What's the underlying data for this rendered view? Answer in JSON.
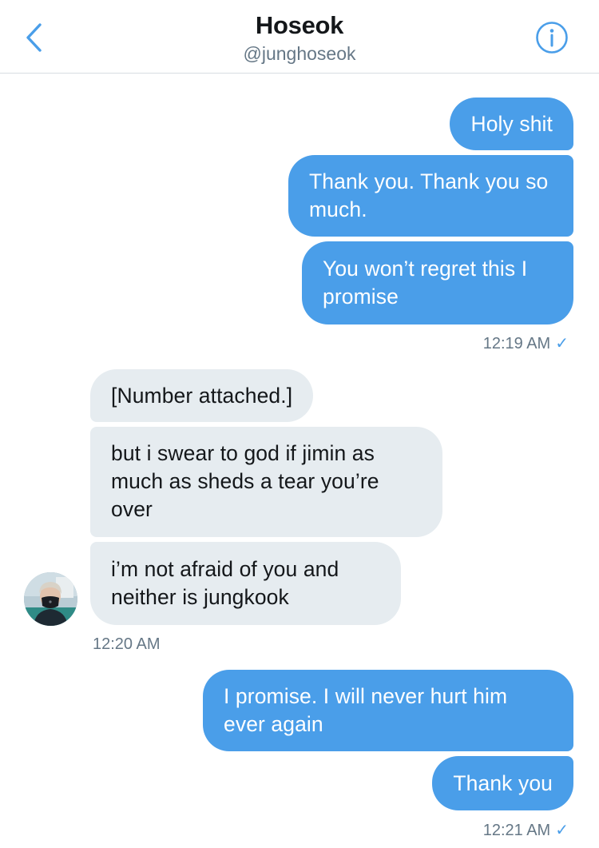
{
  "header": {
    "name": "Hoseok",
    "handle": "@junghoseok",
    "back_icon": "chevron-left-icon",
    "info_icon": "info-icon"
  },
  "colors": {
    "sent_bubble": "#4a9ee9",
    "received_bubble": "#e6ecf0",
    "accent": "#4a9ee9"
  },
  "messages": [
    {
      "direction": "sent",
      "text": "Holy shit"
    },
    {
      "direction": "sent",
      "text": "Thank you. Thank you so much."
    },
    {
      "direction": "sent",
      "text": "You won’t regret this I promise"
    },
    {
      "direction": "received",
      "text": "[Number attached.]"
    },
    {
      "direction": "received",
      "text": "but i swear to god if jimin as much as sheds a tear you’re over"
    },
    {
      "direction": "received",
      "text": "i’m not afraid of you and neither is jungkook"
    },
    {
      "direction": "sent",
      "text": "I promise. I will never hurt him ever again"
    },
    {
      "direction": "sent",
      "text": "Thank you"
    }
  ],
  "timestamps": {
    "group1": "12:19 AM",
    "group2": "12:20 AM",
    "group3": "12:21 AM",
    "read_mark": "✓"
  }
}
